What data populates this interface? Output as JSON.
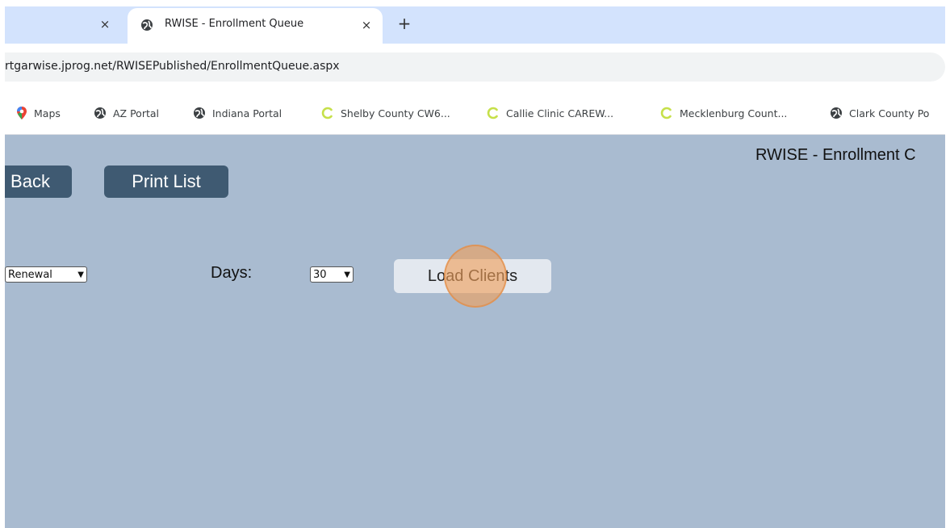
{
  "tabs": {
    "active_title": "RWISE - Enrollment Queue",
    "close_glyph": "×",
    "new_tab_glyph": "+"
  },
  "address_bar": {
    "url": "rtgarwise.jprog.net/RWISEPublished/EnrollmentQueue.aspx"
  },
  "bookmarks": [
    {
      "label": "Maps",
      "icon": "maps-pin-icon"
    },
    {
      "label": "AZ Portal",
      "icon": "globe-icon"
    },
    {
      "label": "Indiana Portal",
      "icon": "globe-icon"
    },
    {
      "label": "Shelby County CW6...",
      "icon": "loading-c-icon"
    },
    {
      "label": "Callie Clinic CAREW...",
      "icon": "loading-c-icon"
    },
    {
      "label": "Mecklenburg Count...",
      "icon": "loading-c-icon"
    },
    {
      "label": "Clark County Po",
      "icon": "globe-icon"
    }
  ],
  "page": {
    "title": "RWISE - Enrollment C",
    "back_label": "Back",
    "print_label": "Print List",
    "type_select_value": "Renewal",
    "days_label": "Days:",
    "days_select_value": "30",
    "load_label": "Load Clients"
  },
  "colors": {
    "tab_strip": "#d3e3fd",
    "content_bg": "#a9bbd0",
    "dark_button": "#3f5a72",
    "load_button": "#e3e8ef",
    "cursor_highlight": "#f0a05a"
  }
}
